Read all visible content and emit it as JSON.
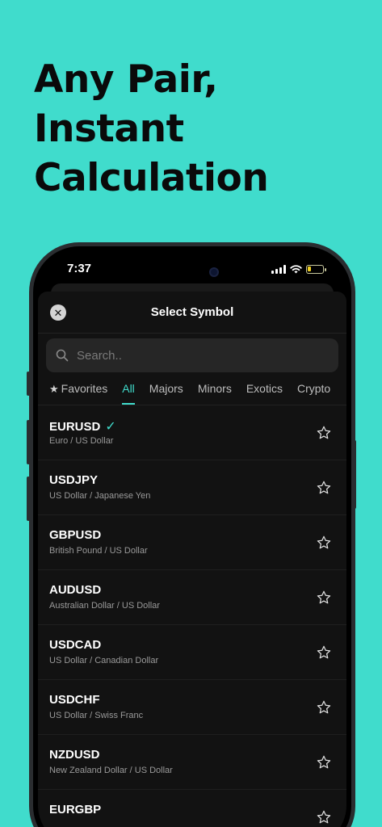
{
  "headline": {
    "line1": "Any Pair,",
    "line2": "Instant",
    "line3": "Calculation"
  },
  "status": {
    "time": "7:37"
  },
  "sheet": {
    "title": "Select Symbol",
    "close_icon": "close-icon",
    "search_placeholder": "Search..",
    "search_value": ""
  },
  "tabs": [
    {
      "label": "Favorites",
      "icon": "star-icon",
      "active": false
    },
    {
      "label": "All",
      "active": true
    },
    {
      "label": "Majors",
      "active": false
    },
    {
      "label": "Minors",
      "active": false
    },
    {
      "label": "Exotics",
      "active": false
    },
    {
      "label": "Crypto",
      "active": false
    }
  ],
  "symbols": [
    {
      "symbol": "EURUSD",
      "name": "Euro / US Dollar",
      "selected": true
    },
    {
      "symbol": "USDJPY",
      "name": "US Dollar / Japanese Yen",
      "selected": false
    },
    {
      "symbol": "GBPUSD",
      "name": "British Pound / US Dollar",
      "selected": false
    },
    {
      "symbol": "AUDUSD",
      "name": "Australian Dollar / US Dollar",
      "selected": false
    },
    {
      "symbol": "USDCAD",
      "name": "US Dollar / Canadian Dollar",
      "selected": false
    },
    {
      "symbol": "USDCHF",
      "name": "US Dollar / Swiss Franc",
      "selected": false
    },
    {
      "symbol": "NZDUSD",
      "name": "New Zealand Dollar / US Dollar",
      "selected": false
    },
    {
      "symbol": "EURGBP",
      "name": "",
      "selected": false
    }
  ],
  "colors": {
    "background": "#40DCCC",
    "accent": "#40DCCC",
    "sheet": "#121212"
  }
}
